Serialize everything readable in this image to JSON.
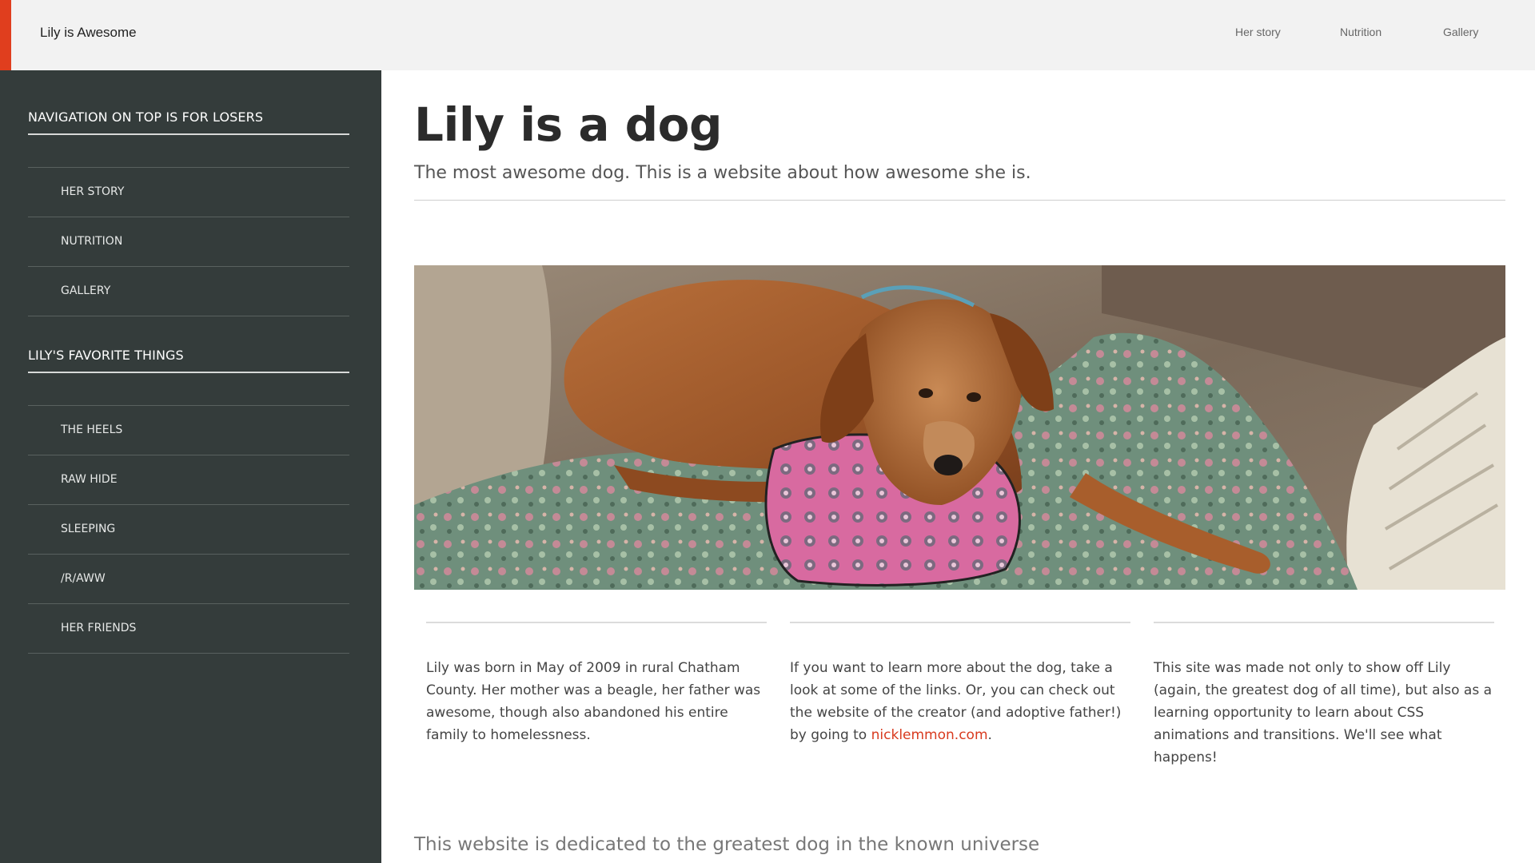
{
  "header": {
    "brand": "Lily is Awesome",
    "nav": [
      "Her story",
      "Nutrition",
      "Gallery"
    ],
    "accent_color": "#e03e1e"
  },
  "sidebar": {
    "sections": [
      {
        "heading": "NAVIGATION ON TOP IS FOR LOSERS",
        "items": [
          "HER STORY",
          "NUTRITION",
          "GALLERY"
        ]
      },
      {
        "heading": "LILY'S FAVORITE THINGS",
        "items": [
          "THE HEELS",
          "RAW HIDE",
          "SLEEPING",
          "/R/AWW",
          "HER FRIENDS"
        ]
      }
    ],
    "background_color": "#343c3b"
  },
  "main": {
    "title": "Lily is a dog",
    "subtitle": "The most awesome dog. This is a website about how awesome she is.",
    "hero_image": "dog-on-couch-photo",
    "columns": [
      {
        "text": "Lily was born in May of 2009 in rural Chatham County. Her mother was a beagle, her father was awesome, though also abandoned his entire family to homelessness."
      },
      {
        "text_before": "If you want to learn more about the dog, take a look at some of the links. Or, you can check out the website of the creator (and adoptive father!) by going to ",
        "link": "nicklemmon.com",
        "text_after": "."
      },
      {
        "text": "This site was made not only to show off Lily (again, the greatest dog of all time), but also as a learning opportunity to learn about CSS animations and transitions. We'll see what happens!"
      }
    ],
    "footer": "This website is dedicated to the greatest dog in the known universe",
    "link_color": "#d83a1e"
  }
}
